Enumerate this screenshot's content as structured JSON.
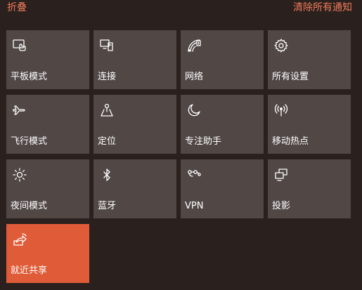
{
  "header": {
    "collapse_label": "折叠",
    "clear_all_label": "清除所有通知"
  },
  "colors": {
    "background": "#2a211e",
    "tile": "#514846",
    "tile_active": "#e05b37",
    "link": "#f07a5a"
  },
  "tiles": [
    {
      "label": "平板模式",
      "icon": "tablet-mode-icon",
      "active": false
    },
    {
      "label": "连接",
      "icon": "connect-icon",
      "active": false
    },
    {
      "label": "网络",
      "icon": "network-icon",
      "active": false
    },
    {
      "label": "所有设置",
      "icon": "gear-icon",
      "active": false
    },
    {
      "label": "飞行模式",
      "icon": "airplane-icon",
      "active": false
    },
    {
      "label": "定位",
      "icon": "location-icon",
      "active": false
    },
    {
      "label": "专注助手",
      "icon": "moon-icon",
      "active": false
    },
    {
      "label": "移动热点",
      "icon": "hotspot-icon",
      "active": false
    },
    {
      "label": "夜间模式",
      "icon": "brightness-icon",
      "active": false
    },
    {
      "label": "蓝牙",
      "icon": "bluetooth-icon",
      "active": false
    },
    {
      "label": "VPN",
      "icon": "vpn-icon",
      "active": false
    },
    {
      "label": "投影",
      "icon": "project-icon",
      "active": false
    },
    {
      "label": "就近共享",
      "icon": "nearby-share-icon",
      "active": true
    }
  ]
}
